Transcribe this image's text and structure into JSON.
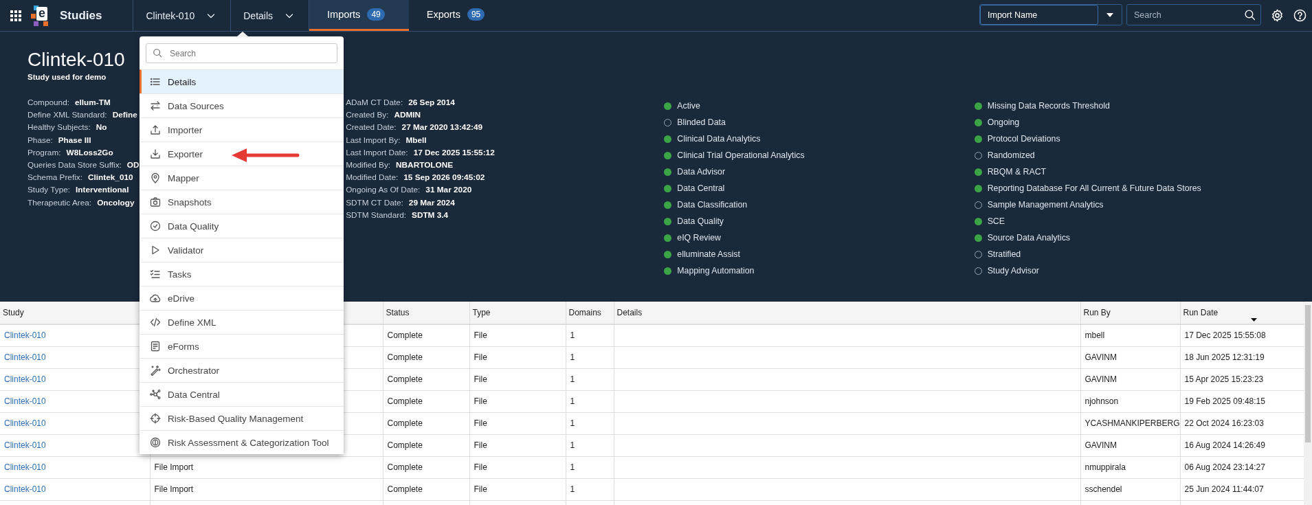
{
  "top_bar": {
    "logo_letter": "e",
    "app_title": "Studies",
    "study_selector": "Clintek-010",
    "section_selector": "Details",
    "tabs": [
      {
        "label": "Imports",
        "count": "49",
        "selected": true
      },
      {
        "label": "Exports",
        "count": "95",
        "selected": false
      }
    ],
    "filter_select": {
      "value": "Import Name"
    },
    "search": {
      "placeholder": "Search"
    }
  },
  "study": {
    "title": "Clintek-010",
    "subtitle": "Study used for demo",
    "properties_left": [
      {
        "label": "Compound:",
        "value": "ellum-TM"
      },
      {
        "label": "Define XML Standard:",
        "value": "Define"
      },
      {
        "label": "Healthy Subjects:",
        "value": "No"
      },
      {
        "label": "Phase:",
        "value": "Phase III"
      },
      {
        "label": "Program:",
        "value": "W8Loss2Go"
      },
      {
        "label": "Queries Data Store Suffix:",
        "value": "OD"
      },
      {
        "label": "Schema Prefix:",
        "value": "Clintek_010"
      },
      {
        "label": "Study Type:",
        "value": "Interventional"
      },
      {
        "label": "Therapeutic Area:",
        "value": "Oncology"
      }
    ],
    "properties_right": [
      {
        "label": "ADaM CT Date:",
        "value": "26 Sep 2014"
      },
      {
        "label": "Created By:",
        "value": "ADMIN"
      },
      {
        "label": "Created Date:",
        "value": "27 Mar 2020 13:42:49"
      },
      {
        "label": "Last Import By:",
        "value": "Mbell"
      },
      {
        "label": "Last Import Date:",
        "value": "17 Dec 2025 15:55:12"
      },
      {
        "label": "Modified By:",
        "value": "NBARTOLONE"
      },
      {
        "label": "Modified Date:",
        "value": "15 Sep 2026 09:45:02"
      },
      {
        "label": "Ongoing As Of Date:",
        "value": "31 Mar 2020"
      },
      {
        "label": "SDTM CT Date:",
        "value": "29 Mar 2024"
      },
      {
        "label": "SDTM Standard:",
        "value": "SDTM 3.4"
      }
    ],
    "features_left": [
      {
        "name": "Active",
        "on": true
      },
      {
        "name": "Blinded Data",
        "on": false
      },
      {
        "name": "Clinical Data Analytics",
        "on": true
      },
      {
        "name": "Clinical Trial Operational Analytics",
        "on": true
      },
      {
        "name": "Data Advisor",
        "on": true
      },
      {
        "name": "Data Central",
        "on": true
      },
      {
        "name": "Data Classification",
        "on": true
      },
      {
        "name": "Data Quality",
        "on": true
      },
      {
        "name": "eIQ Review",
        "on": true
      },
      {
        "name": "elluminate Assist",
        "on": true
      },
      {
        "name": "Mapping Automation",
        "on": true
      }
    ],
    "features_right": [
      {
        "name": "Missing Data Records Threshold",
        "on": true
      },
      {
        "name": "Ongoing",
        "on": true
      },
      {
        "name": "Protocol Deviations",
        "on": true
      },
      {
        "name": "Randomized",
        "on": false
      },
      {
        "name": "RBQM & RACT",
        "on": true
      },
      {
        "name": "Reporting Database For All Current & Future Data Stores",
        "on": true
      },
      {
        "name": "Sample Management Analytics",
        "on": false
      },
      {
        "name": "SCE",
        "on": true
      },
      {
        "name": "Source Data Analytics",
        "on": true
      },
      {
        "name": "Stratified",
        "on": false
      },
      {
        "name": "Study Advisor",
        "on": false
      }
    ]
  },
  "menu": {
    "search_placeholder": "Search",
    "items": [
      {
        "label": "Details",
        "selected": true
      },
      {
        "label": "Data Sources",
        "selected": false
      },
      {
        "label": "Importer",
        "selected": false
      },
      {
        "label": "Exporter",
        "selected": false
      },
      {
        "label": "Mapper",
        "selected": false
      },
      {
        "label": "Snapshots",
        "selected": false
      },
      {
        "label": "Data Quality",
        "selected": false
      },
      {
        "label": "Validator",
        "selected": false
      },
      {
        "label": "Tasks",
        "selected": false
      },
      {
        "label": "eDrive",
        "selected": false
      },
      {
        "label": "Define XML",
        "selected": false
      },
      {
        "label": "eForms",
        "selected": false
      },
      {
        "label": "Orchestrator",
        "selected": false
      },
      {
        "label": "Data Central",
        "selected": false
      },
      {
        "label": "Risk-Based Quality Management",
        "selected": false
      },
      {
        "label": "Risk Assessment & Categorization Tool",
        "selected": false
      }
    ]
  },
  "table": {
    "columns": {
      "study": {
        "label": "Study"
      },
      "status": {
        "label": "Status"
      },
      "type": {
        "label": "Type"
      },
      "domains": {
        "label": "Domains"
      },
      "details": {
        "label": "Details"
      },
      "run_by": {
        "label": "Run By"
      },
      "run_date": {
        "label": "Run Date",
        "sort_descending": true
      }
    },
    "rows": [
      {
        "study": "Clintek-010",
        "status": "Complete",
        "type": "File",
        "domains": "1",
        "run_by": "mbell",
        "run_date": "17 Dec 2025 15:55:08"
      },
      {
        "study": "Clintek-010",
        "status": "Complete",
        "type": "File",
        "domains": "1",
        "run_by": "GAVINM",
        "run_date": "18 Jun 2025 12:31:19"
      },
      {
        "study": "Clintek-010",
        "status": "Complete",
        "type": "File",
        "domains": "1",
        "run_by": "GAVINM",
        "run_date": "15 Apr 2025 15:23:23"
      },
      {
        "study": "Clintek-010",
        "status": "Complete",
        "type": "File",
        "domains": "1",
        "run_by": "njohnson",
        "run_date": "19 Feb 2025 09:48:15"
      },
      {
        "study": "Clintek-010",
        "status": "Complete",
        "type": "File",
        "domains": "1",
        "run_by": "YCASHMANKIPERBERG",
        "run_date": "22 Oct 2024 16:23:03"
      },
      {
        "study": "Clintek-010",
        "status": "Complete",
        "type": "File",
        "domains": "1",
        "run_by": "GAVINM",
        "run_date": "16 Aug 2024 14:26:49"
      },
      {
        "study": "Clintek-010",
        "column_2": "File Import",
        "status": "Complete",
        "type": "File",
        "domains": "1",
        "run_by": "nmuppirala",
        "run_date": "06 Aug 2024 23:14:27"
      },
      {
        "study": "Clintek-010",
        "column_2": "File Import",
        "status": "Complete",
        "type": "File",
        "domains": "1",
        "run_by": "sschendel",
        "run_date": "25 Jun 2024 11:44:07"
      }
    ]
  }
}
